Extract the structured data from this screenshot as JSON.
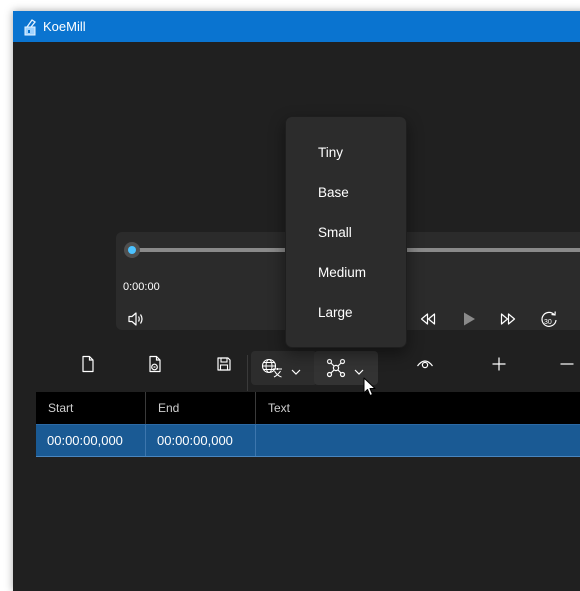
{
  "window": {
    "title": "KoeMill"
  },
  "player": {
    "current_time": "0:00:00",
    "skip_label": "30"
  },
  "model_menu": {
    "items": [
      "Tiny",
      "Base",
      "Small",
      "Medium",
      "Large"
    ]
  },
  "table": {
    "columns": [
      "Start",
      "End",
      "Text"
    ],
    "rows": [
      {
        "start": "00:00:00,000",
        "end": "00:00:00,000",
        "text": ""
      }
    ]
  },
  "colors": {
    "accent": "#0a74d0",
    "selection": "#1a5a94",
    "slider": "#4cc2ff"
  }
}
